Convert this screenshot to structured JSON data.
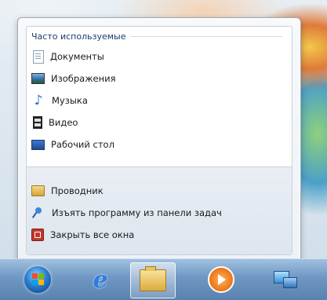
{
  "jumplist": {
    "frequent_header": "Часто используемые",
    "frequent_items": [
      {
        "label": "Документы",
        "icon": "documents-icon"
      },
      {
        "label": "Изображения",
        "icon": "pictures-icon"
      },
      {
        "label": "Музыка",
        "icon": "music-icon"
      },
      {
        "label": "Видео",
        "icon": "video-icon"
      },
      {
        "label": "Рабочий стол",
        "icon": "desktop-icon"
      }
    ],
    "tasks": [
      {
        "label": "Проводник",
        "icon": "explorer-folder-icon"
      },
      {
        "label": "Изъять программу из панели задач",
        "icon": "unpin-icon"
      },
      {
        "label": "Закрыть все окна",
        "icon": "close-windows-icon"
      }
    ]
  },
  "taskbar": {
    "buttons": [
      {
        "name": "start-button",
        "icon": "windows-orb-icon"
      },
      {
        "name": "internet-explorer",
        "icon": "internet-explorer-icon"
      },
      {
        "name": "windows-explorer",
        "icon": "folder-icon",
        "active": true
      },
      {
        "name": "media-player",
        "icon": "media-player-icon"
      },
      {
        "name": "network",
        "icon": "network-icon"
      }
    ]
  }
}
